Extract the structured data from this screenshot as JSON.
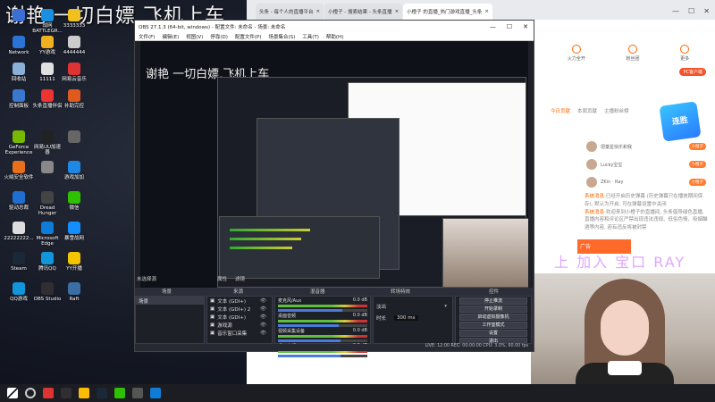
{
  "desktop": {
    "banner_text": "谢艳 一切白嫖,飞机上车",
    "icons": [
      {
        "label": "",
        "color": "#3b6fd6"
      },
      {
        "label": "战网\nBATTLEGR...",
        "color": "#1a8fe0"
      },
      {
        "label": "3333333",
        "color": "#f0c020"
      },
      {
        "label": "Network",
        "color": "#2a74d8"
      },
      {
        "label": "YY游戏",
        "color": "#f0b020"
      },
      {
        "label": "4444444",
        "color": "#ccc"
      },
      {
        "label": "回收站",
        "color": "#8bb0d8"
      },
      {
        "label": "11111",
        "color": "#e0e0e0"
      },
      {
        "label": "网易云音乐",
        "color": "#d33"
      },
      {
        "label": "控制面板",
        "color": "#3a78d0"
      },
      {
        "label": "头条直播伴侣",
        "color": "#e33"
      },
      {
        "label": "补助完控",
        "color": "#e05a20"
      },
      {
        "label": "GeForce\nExperience",
        "color": "#76b900"
      },
      {
        "label": "网易UU加速器",
        "color": "#222"
      },
      {
        "label": "",
        "color": "#666"
      },
      {
        "label": "火绒安全软件",
        "color": "#e8701a"
      },
      {
        "label": "",
        "color": "#888"
      },
      {
        "label": "游戏加加",
        "color": "#1e88e5"
      },
      {
        "label": "驱动总裁",
        "color": "#1f6fd0"
      },
      {
        "label": "Dread\nHunger",
        "color": "#444"
      },
      {
        "label": "微信",
        "color": "#2dc100"
      },
      {
        "label": "22222222...",
        "color": "#ddd"
      },
      {
        "label": "Microsoft\nEdge",
        "color": "#0f7cd8"
      },
      {
        "label": "暴雪战网",
        "color": "#148eff"
      },
      {
        "label": "Steam",
        "color": "#1b2838"
      },
      {
        "label": "腾讯QQ",
        "color": "#1296db"
      },
      {
        "label": "YY开播",
        "color": "#f5c400"
      },
      {
        "label": "QQ游戏",
        "color": "#1296db"
      },
      {
        "label": "OBS Studio",
        "color": "#302e31"
      },
      {
        "label": "Raft",
        "color": "#3a6ea5"
      }
    ]
  },
  "browser": {
    "tabs": [
      {
        "label": "头条 - 每个人的直播平台",
        "active": false
      },
      {
        "label": "小橙子 - 搜索结果 - 头条直播",
        "active": false
      },
      {
        "label": "小橙子 的直播_热门游戏直播_头条",
        "active": true
      }
    ],
    "right_panel": {
      "icons": [
        "火力全开",
        "粉丝团",
        "更多"
      ],
      "pc_badge": "PC客户端",
      "tabs": [
        "今日贡献",
        "本周贡献",
        "主播粉丝榜"
      ],
      "rate_badge": "连胜",
      "viewers": [
        {
          "name": "把童星快乐和我",
          "tag": "小橙子"
        },
        {
          "name": "Lucky宝宝",
          "tag": "小橙子"
        },
        {
          "name": "ZKin · Ray",
          "tag": "小橙子"
        }
      ],
      "messages": [
        {
          "prefix": "系统消息:",
          "text": "已经开启历史弹幕 (历史弹幕只在播放期间保存), 默认为开启, 可在弹幕设置中关闭"
        },
        {
          "prefix": "系统消息:",
          "text": "欢迎来到小橙子的直播间, 头条倡导绿色直播, 直播内容和评论区严禁出现违法违规、低俗色情、吸烟酗酒等内容, 若有违反将被封禁"
        }
      ],
      "ad_banner": "广告",
      "ray_text": "上 加入 宝口 RAY"
    }
  },
  "obs": {
    "title": "OBS 27.1.3 (64-bit, windows) - 配置文件: 未命名 - 场景: 未命名",
    "menu": [
      "文件(F)",
      "编辑(E)",
      "视图(V)",
      "停靠(D)",
      "配置文件(P)",
      "场景集合(S)",
      "工具(T)",
      "帮助(H)"
    ],
    "preview_banner": "谢艳 一切白嫖,飞机上车",
    "dock_headers": {
      "scenes": "场景",
      "sources": "来源",
      "mixer": "混音器",
      "transitions": "转场特效",
      "controls": "控件"
    },
    "no_source_label": "未选择源",
    "props_label": "属性",
    "filters_label": "滤镜",
    "scenes": [
      "场景"
    ],
    "sources": [
      "文本 (GDI+)",
      "文本 (GDI+) 2",
      "文本 (GDI+)",
      "游戏源",
      "音乐窗口采集"
    ],
    "mixer": [
      {
        "name": "麦克风/Aux",
        "db": "0.0 dB",
        "level": 0.72
      },
      {
        "name": "桌面音频",
        "db": "0.0 dB",
        "level": 0.68
      },
      {
        "name": "视频采集设备",
        "db": "0.0 dB",
        "level": 0.7
      },
      {
        "name": "桌面音频 2",
        "db": "0.0 dB",
        "level": 0.7
      }
    ],
    "transition": {
      "type": "淡出",
      "duration_label": "时长",
      "duration": "300 ms"
    },
    "controls": [
      "停止推流",
      "开始录制",
      "启动虚拟摄像机",
      "工作室模式",
      "设置",
      "退出"
    ],
    "status": "LIVE: 12:00  REC: 00:00:00  CPU: 3.0%, 60.00 fps",
    "tools": [
      "+",
      "−",
      "∧",
      "∨"
    ]
  },
  "taskbar": {
    "items": [
      "start-icon",
      "search-icon",
      "netease-icon",
      "obs-icon",
      "chrome-icon",
      "steam-icon",
      "wechat-icon",
      "obs-live-icon",
      "edge-icon"
    ]
  }
}
